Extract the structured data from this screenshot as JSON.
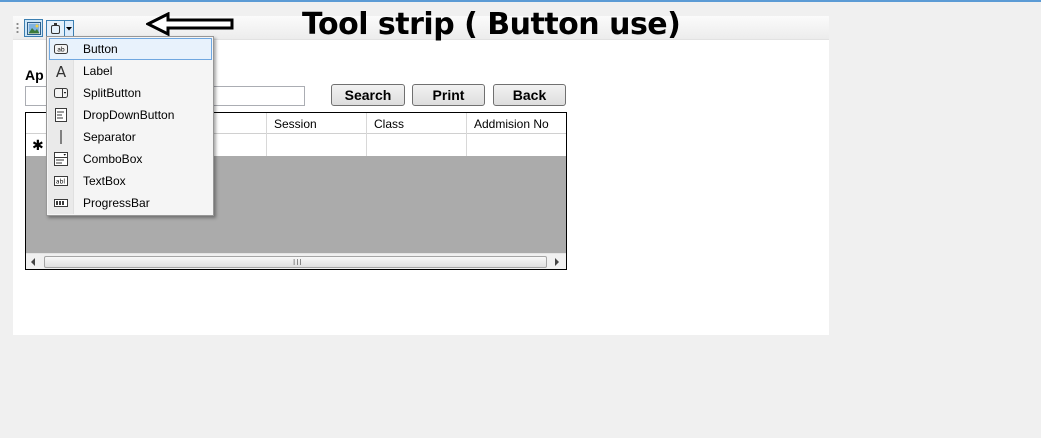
{
  "annotation": {
    "text": "Tool strip ( Button use)"
  },
  "form": {
    "label": "Ap",
    "search_value": ""
  },
  "buttons": {
    "search": "Search",
    "print": "Print",
    "back": "Back"
  },
  "grid": {
    "columns": [
      "",
      "Session",
      "Class",
      "Addmision No"
    ],
    "new_row_marker": "✱",
    "scroll_grip": "III"
  },
  "dropdown_menu": {
    "items": [
      {
        "label": "Button",
        "icon": "button-icon",
        "selected": true
      },
      {
        "label": "Label",
        "icon": "label-icon"
      },
      {
        "label": "SplitButton",
        "icon": "split-button-icon"
      },
      {
        "label": "DropDownButton",
        "icon": "dropdown-button-icon"
      },
      {
        "label": "Separator",
        "icon": "separator-icon"
      },
      {
        "label": "ComboBox",
        "icon": "combobox-icon"
      },
      {
        "label": "TextBox",
        "icon": "textbox-icon"
      },
      {
        "label": "ProgressBar",
        "icon": "progressbar-icon"
      }
    ]
  },
  "colors": {
    "accent": "#5b9bd5",
    "selection_border": "#6fa7e0",
    "grid_background": "#ababab"
  }
}
